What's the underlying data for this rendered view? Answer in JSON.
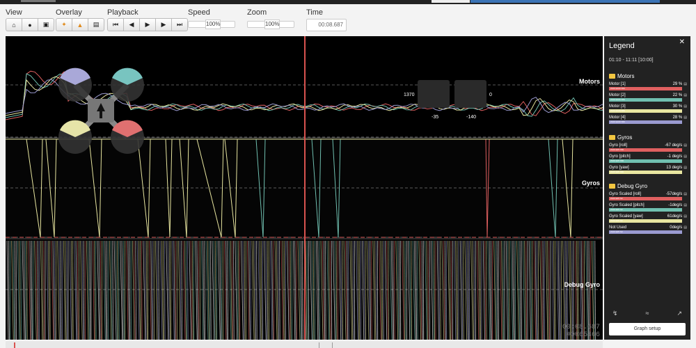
{
  "toolbar": {
    "view_label": "View",
    "overlay_label": "Overlay",
    "playback_label": "Playback",
    "speed_label": "Speed",
    "speed_value": "100%",
    "zoom_label": "Zoom",
    "zoom_value": "100%",
    "time_label": "Time",
    "time_value": "00:08.687"
  },
  "graphs": {
    "motors_label": "Motors",
    "gyros_label": "Gyros",
    "debug_label": "Debug Gyro",
    "stick_left_x": "1370",
    "stick_left_y": "-35",
    "stick_right_x": "0",
    "stick_right_y": "-140",
    "overlay_time": "00:08.687",
    "overlay_frame": "#0065466"
  },
  "legend": {
    "title": "Legend",
    "range": "01:10 - 11:11 [10:00]",
    "groups": [
      {
        "name": "Motors",
        "items": [
          {
            "label": "Motor [1]",
            "value": "29 %",
            "color": "#e06060",
            "bar": "Z100 E100 S50"
          },
          {
            "label": "Motor [2]",
            "value": "22 %",
            "color": "#70c0b0",
            "bar": "Z100 E100 S50"
          },
          {
            "label": "Motor [3]",
            "value": "30 %",
            "color": "#e8e6a0",
            "bar": "Z100 E100 S50"
          },
          {
            "label": "Motor [4]",
            "value": "28 %",
            "color": "#9a9ad0",
            "bar": "Z100 E100 S50"
          }
        ]
      },
      {
        "name": "Gyros",
        "items": [
          {
            "label": "Gyro [roll]",
            "value": "-67 deg/s",
            "color": "#e06060",
            "bar": "Z100 E25 S50"
          },
          {
            "label": "Gyro [pitch]",
            "value": "-1 deg/s",
            "color": "#70c0b0",
            "bar": "Z100 E25 S50"
          },
          {
            "label": "Gyro [yaw]",
            "value": "13 deg/s",
            "color": "#e8e6a0",
            "bar": "Z100 E25 S50"
          }
        ]
      },
      {
        "name": "Debug Gyro",
        "items": [
          {
            "label": "Gyro Scaled [roll]",
            "value": "-57deg/s",
            "color": "#e06060",
            "bar": "Z100 E25 S0"
          },
          {
            "label": "Gyro Scaled [pitch]",
            "value": "-1deg/s",
            "color": "#70c0b0",
            "bar": "Z100 E25 S0"
          },
          {
            "label": "Gyro Scaled [yaw]",
            "value": "61deg/s",
            "color": "#e8e6a0",
            "bar": "Z100 E25 S0"
          },
          {
            "label": "Not Used",
            "value": "0deg/s",
            "color": "#9a9ad0",
            "bar": "Z100 E25 S0"
          }
        ]
      }
    ],
    "setup_button": "Graph setup"
  }
}
